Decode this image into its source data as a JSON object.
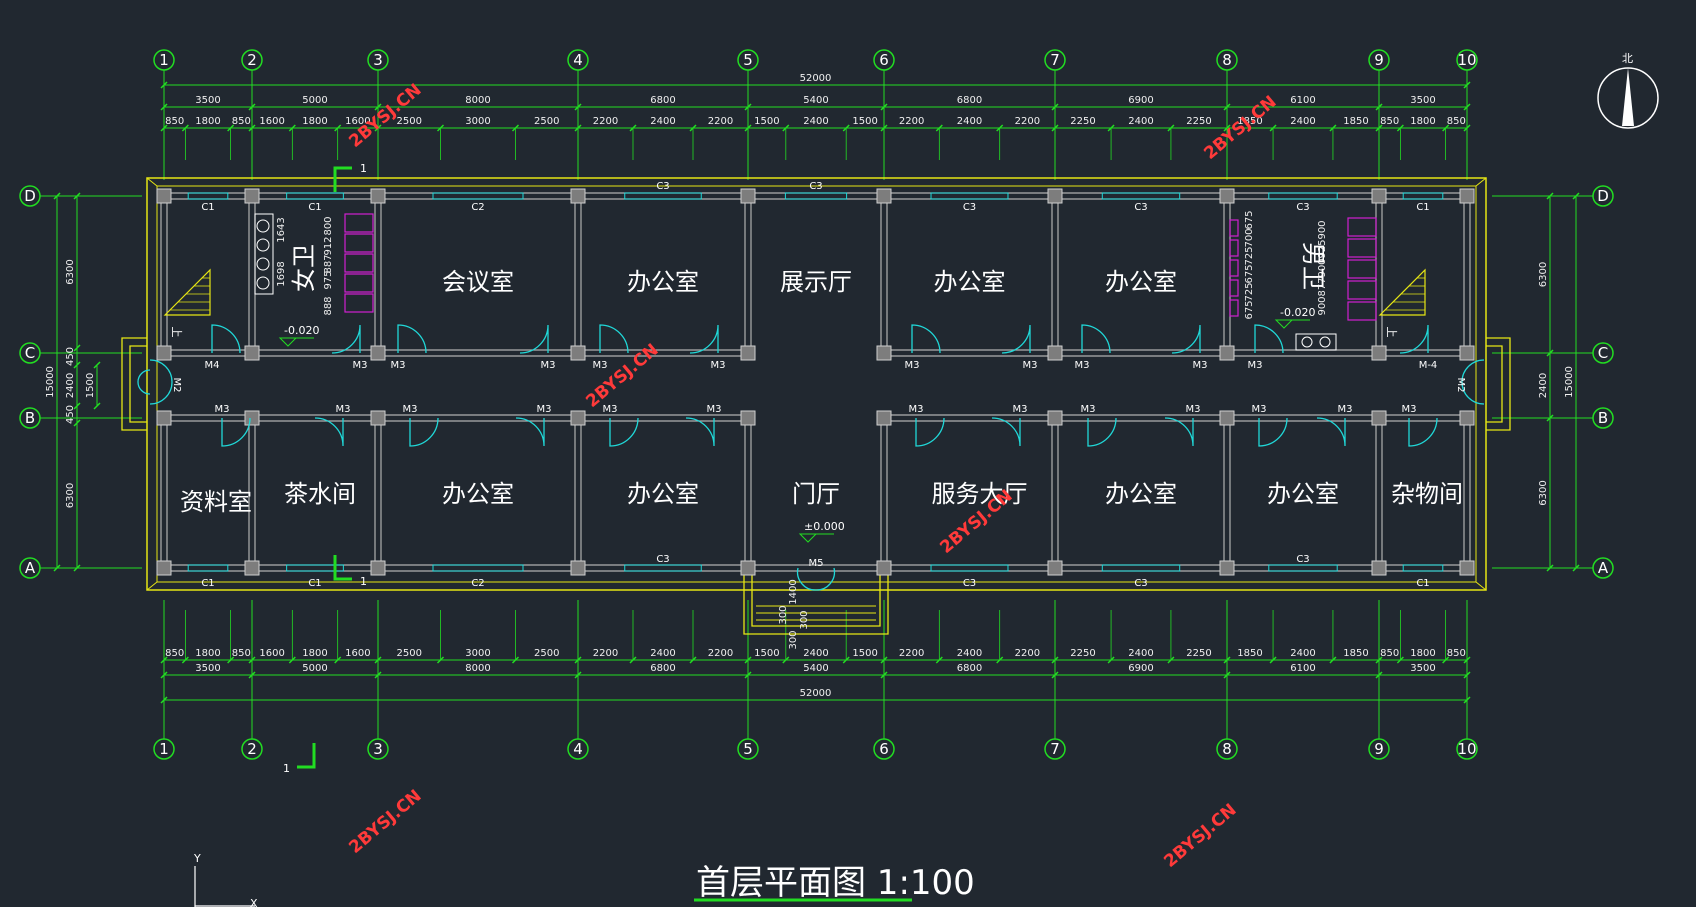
{
  "title": "首层平面图 1:100",
  "north": "北",
  "axes_x": [
    "1",
    "2",
    "3",
    "4",
    "5",
    "6",
    "7",
    "8",
    "9",
    "10"
  ],
  "axes_y": [
    "A",
    "B",
    "C",
    "D"
  ],
  "dims_total": "52000",
  "dims_top_bays": [
    "3500",
    "5000",
    "8000",
    "6800",
    "5400",
    "6800",
    "6900",
    "6100",
    "3500"
  ],
  "dims_top_windows": [
    "850",
    "1800",
    "850",
    "1600",
    "1800",
    "1600",
    "2500",
    "3000",
    "2500",
    "2200",
    "2400",
    "2200",
    "1500",
    "2400",
    "1500",
    "2200",
    "2400",
    "2200",
    "2250",
    "2400",
    "2250",
    "1850",
    "2400",
    "1850",
    "850",
    "1800",
    "850"
  ],
  "dims_left": [
    "6300",
    "450",
    "2400",
    "450",
    "6300"
  ],
  "dims_left_total": "15000",
  "dims_left_corr": "1500",
  "dims_right": [
    "6300",
    "2400",
    "6300"
  ],
  "dims_right_total": "15000",
  "rooms_north": [
    "会议室",
    "办公室",
    "展示厅",
    "办公室",
    "办公室"
  ],
  "rooms_south": [
    "资料室",
    "茶水间",
    "办公室",
    "办公室",
    "门厅",
    "服务大厅",
    "办公室",
    "办公室",
    "杂物间"
  ],
  "wc_female": "女卫",
  "wc_male": "男卫",
  "windows_north": [
    "C1",
    "C1",
    "C2",
    "C3",
    "C3",
    "C3",
    "C3",
    "C3",
    "C1"
  ],
  "windows_south": [
    "C1",
    "C1",
    "C2",
    "C3",
    "C3",
    "C3",
    "C3",
    "C1"
  ],
  "doors_c_line": [
    "M4",
    "M3",
    "M3",
    "M3",
    "M3",
    "M3",
    "M3",
    "M3",
    "M3",
    "M3",
    "M3",
    "M-4"
  ],
  "doors_b_line": [
    "M3",
    "M3",
    "M3",
    "M3",
    "M3",
    "M3",
    "M3",
    "M3",
    "M3",
    "M3",
    "M3",
    "M3",
    "M3"
  ],
  "door_end_left": "M2",
  "door_end_right": "M2",
  "door_entrance": "M5",
  "elev_zero": "±0.000",
  "elev_wc_left": "-0.020",
  "elev_wc_right": "-0.020",
  "stair_up": "上",
  "wc_dims_left": [
    "1643",
    "1698",
    "800",
    "912",
    "887",
    "975",
    "888"
  ],
  "wc_dims_right": [
    "675",
    "725",
    "675",
    "725",
    "700",
    "675",
    "900",
    "925",
    "900",
    "877",
    "900"
  ],
  "entrance_dims": [
    "1400",
    "300",
    "300",
    "300"
  ],
  "section_mark": "1",
  "watermark": "2BYSJ.CN",
  "ucs_y": "Y",
  "ucs_x": "X",
  "colors": {
    "background": "#212830",
    "dim_lines": "#22dd22",
    "outline": "#e6e614",
    "fixture": "#d020d0",
    "doors": "#20d8d8",
    "walls": "#b0b0b0"
  }
}
